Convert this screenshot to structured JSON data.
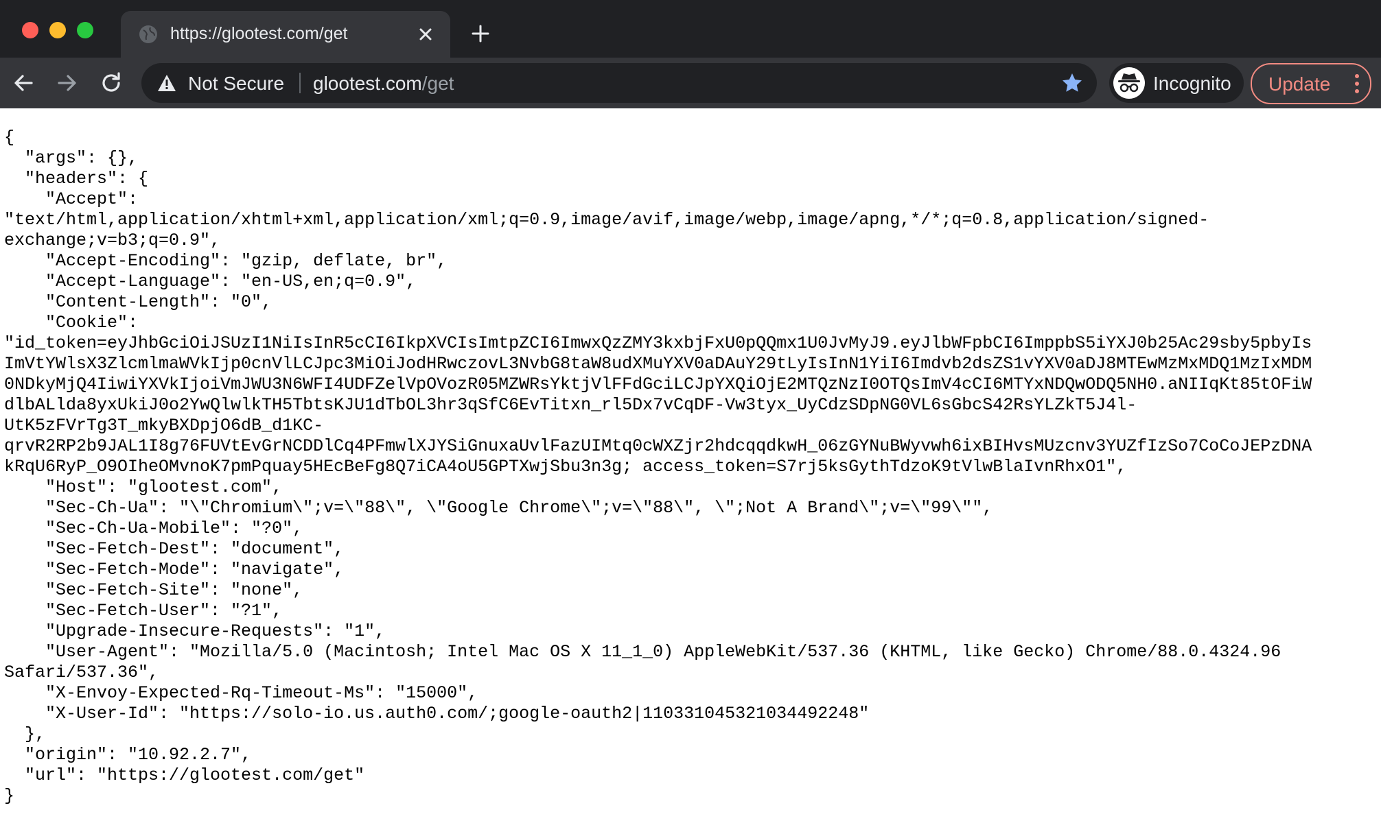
{
  "browser": {
    "tab": {
      "title": "https://glootest.com/get"
    },
    "omnibox": {
      "security_label": "Not Secure",
      "url_host": "glootest.com",
      "url_path": "/get"
    },
    "incognito_label": "Incognito",
    "update_label": "Update"
  },
  "page": {
    "json_lines": [
      "{",
      "  \"args\": {},",
      "  \"headers\": {",
      "    \"Accept\":",
      "\"text/html,application/xhtml+xml,application/xml;q=0.9,image/avif,image/webp,image/apng,*/*;q=0.8,application/signed-",
      "exchange;v=b3;q=0.9\",",
      "    \"Accept-Encoding\": \"gzip, deflate, br\",",
      "    \"Accept-Language\": \"en-US,en;q=0.9\",",
      "    \"Content-Length\": \"0\",",
      "    \"Cookie\":",
      "\"id_token=eyJhbGciOiJSUzI1NiIsInR5cCI6IkpXVCIsImtpZCI6ImwxQzZMY3kxbjFxU0pQQmx1U0JvMyJ9.eyJlbWFpbCI6ImppbS5iYXJ0b25Ac29sby5pbyIs",
      "ImVtYWlsX3ZlcmlmaWVkIjp0cnVlLCJpc3MiOiJodHRwczovL3NvbG8taW8udXMuYXV0aDAuY29tLyIsInN1YiI6Imdvb2dsZS1vYXV0aDJ8MTEwMzMxMDQ1MzIxMDM",
      "0NDkyMjQ4IiwiYXVkIjoiVmJWU3N6WFI4UDFZelVpOVozR05MZWRsYktjVlFFdGciLCJpYXQiOjE2MTQzNzI0OTQsImV4cCI6MTYxNDQwODQ5NH0.aNIIqKt85tOFiW",
      "dlbALlda8yxUkiJ0o2YwQlwlkTH5TbtsKJU1dTbOL3hr3qSfC6EvTitxn_rl5Dx7vCqDF-Vw3tyx_UyCdzSDpNG0VL6sGbcS42RsYLZkT5J4l-",
      "UtK5zFVrTg3T_mkyBXDpjO6dB_d1KC-",
      "qrvR2RP2b9JAL1I8g76FUVtEvGrNCDDlCq4PFmwlXJYSiGnuxaUvlFazUIMtq0cWXZjr2hdcqqdkwH_06zGYNuBWyvwh6ixBIHvsMUzcnv3YUZfIzSo7CoCoJEPzDNA",
      "kRqU6RyP_O9OIheOMvnoK7pmPquay5HEcBeFg8Q7iCA4oU5GPTXwjSbu3n3g; access_token=S7rj5ksGythTdzoK9tVlwBlaIvnRhxO1\",",
      "    \"Host\": \"glootest.com\",",
      "    \"Sec-Ch-Ua\": \"\\\"Chromium\\\";v=\\\"88\\\", \\\"Google Chrome\\\";v=\\\"88\\\", \\\";Not A Brand\\\";v=\\\"99\\\"\",",
      "    \"Sec-Ch-Ua-Mobile\": \"?0\",",
      "    \"Sec-Fetch-Dest\": \"document\",",
      "    \"Sec-Fetch-Mode\": \"navigate\",",
      "    \"Sec-Fetch-Site\": \"none\",",
      "    \"Sec-Fetch-User\": \"?1\",",
      "    \"Upgrade-Insecure-Requests\": \"1\",",
      "    \"User-Agent\": \"Mozilla/5.0 (Macintosh; Intel Mac OS X 11_1_0) AppleWebKit/537.36 (KHTML, like Gecko) Chrome/88.0.4324.96",
      "Safari/537.36\",",
      "    \"X-Envoy-Expected-Rq-Timeout-Ms\": \"15000\",",
      "    \"X-User-Id\": \"https://solo-io.us.auth0.com/;google-oauth2|110331045321034492248\"",
      "  },",
      "  \"origin\": \"10.92.2.7\",",
      "  \"url\": \"https://glootest.com/get\"",
      "}"
    ]
  },
  "icons": {
    "tab_favicon": "globe-icon",
    "tab_close": "close-icon",
    "new_tab": "plus-icon",
    "back": "arrow-left-icon",
    "forward": "arrow-right-icon",
    "reload": "reload-icon",
    "security": "warning-icon",
    "bookmark": "star-icon",
    "incognito": "incognito-icon",
    "menu": "vertical-dots-icon"
  },
  "colors": {
    "chrome_dark": "#202124",
    "toolbar": "#35363a",
    "bookmark_star": "#8ab4f8",
    "update_accent": "#f28b82"
  }
}
